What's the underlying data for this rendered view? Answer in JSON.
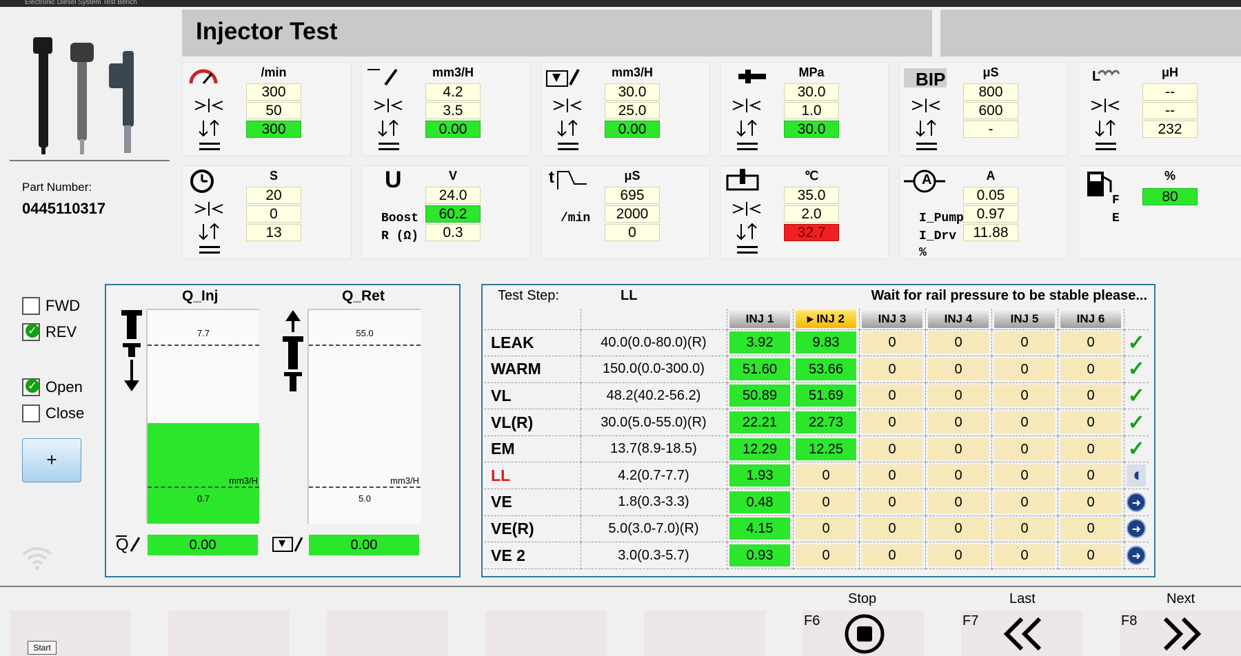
{
  "window": {
    "caption": "Electronic Diesel System Test Bench",
    "title": "Injector Test"
  },
  "part": {
    "label": "Part Number:",
    "value": "0445110317"
  },
  "panels": [
    {
      "unit": "/min",
      "values": [
        "300",
        "50",
        "300"
      ],
      "icon": "speed-gauge-icon"
    },
    {
      "unit": "mm3/H",
      "values": [
        "4.2",
        "3.5",
        "0.00"
      ],
      "icon": "injection-quantity-icon"
    },
    {
      "unit": "mm3/H",
      "values": [
        "30.0",
        "25.0",
        "0.00"
      ],
      "icon": "return-quantity-icon"
    },
    {
      "unit": "MPa",
      "values": [
        "30.0",
        "1.0",
        "30.0"
      ],
      "icon": "rail-pressure-icon"
    },
    {
      "unit": "μS",
      "values": [
        "800",
        "600",
        "-"
      ],
      "icon": "bip-icon",
      "label": "BIP"
    },
    {
      "unit": "μH",
      "values": [
        "--",
        "--",
        "232"
      ],
      "icon": "inductance-icon",
      "label": "L"
    },
    {
      "unit": "S",
      "values": [
        "20",
        "0",
        "13"
      ],
      "icon": "timer-icon"
    },
    {
      "unit": "V",
      "values": [
        "24.0",
        "60.2",
        "0.3"
      ],
      "icon": "voltage-icon",
      "labels": [
        "U",
        "Boost",
        "R (Ω)"
      ]
    },
    {
      "unit": "μS",
      "values": [
        "695",
        "2000",
        "0"
      ],
      "icon": "pulse-width-icon",
      "labels": [
        "t",
        "/min"
      ]
    },
    {
      "unit": "℃",
      "values": [
        "35.0",
        "2.0",
        "32.7"
      ],
      "icon": "temperature-icon"
    },
    {
      "unit": "A",
      "values": [
        "0.05",
        "0.97",
        "11.88"
      ],
      "icon": "current-icon",
      "labels": [
        "A",
        "I_Pump",
        "I_Drv",
        "%"
      ]
    },
    {
      "unit": "%",
      "values": [
        "80"
      ],
      "icon": "fuel-level-icon",
      "labels": [
        "F",
        "E"
      ]
    }
  ],
  "options": {
    "fwd": "FWD",
    "rev": "REV",
    "open": "Open",
    "close": "Close",
    "plus": "+"
  },
  "gauges": {
    "inj": {
      "title": "Q_Inj",
      "upper": "7.7",
      "lower": "0.7",
      "unit": "mm3/H",
      "value": "0.00",
      "fill": 0.47
    },
    "ret": {
      "title": "Q_Ret",
      "upper": "55.0",
      "lower": "5.0",
      "unit": "mm3/H",
      "value": "0.00",
      "fill": 0.0
    }
  },
  "results": {
    "step_label": "Test Step:",
    "step_value": "LL",
    "message": "Wait for rail pressure to be stable please...",
    "columns": [
      "INJ 1",
      "INJ 2",
      "INJ 3",
      "INJ 4",
      "INJ 5",
      "INJ 6"
    ],
    "active_column": "INJ 2",
    "rows": [
      {
        "name": "LEAK",
        "spec": "40.0(0.0-80.0)(R)",
        "values": [
          "3.92",
          "9.83",
          "0",
          "0",
          "0",
          "0"
        ],
        "status": "ok"
      },
      {
        "name": "WARM",
        "spec": "150.0(0.0-300.0)",
        "values": [
          "51.60",
          "53.66",
          "0",
          "0",
          "0",
          "0"
        ],
        "status": "ok"
      },
      {
        "name": "VL",
        "spec": "48.2(40.2-56.2)",
        "values": [
          "50.89",
          "51.69",
          "0",
          "0",
          "0",
          "0"
        ],
        "status": "ok"
      },
      {
        "name": "VL(R)",
        "spec": "30.0(5.0-55.0)(R)",
        "values": [
          "22.21",
          "22.73",
          "0",
          "0",
          "0",
          "0"
        ],
        "status": "ok"
      },
      {
        "name": "EM",
        "spec": "13.7(8.9-18.5)",
        "values": [
          "12.29",
          "12.25",
          "0",
          "0",
          "0",
          "0"
        ],
        "status": "ok"
      },
      {
        "name": "LL",
        "spec": "4.2(0.7-7.7)",
        "values": [
          "1.93",
          "0",
          "0",
          "0",
          "0",
          "0"
        ],
        "status": "busy"
      },
      {
        "name": "VE",
        "spec": "1.8(0.3-3.3)",
        "values": [
          "0.48",
          "0",
          "0",
          "0",
          "0",
          "0"
        ],
        "status": "pending"
      },
      {
        "name": "VE(R)",
        "spec": "5.0(3.0-7.0)(R)",
        "values": [
          "4.15",
          "0",
          "0",
          "0",
          "0",
          "0"
        ],
        "status": "pending"
      },
      {
        "name": "VE 2",
        "spec": "3.0(0.3-5.7)",
        "values": [
          "0.93",
          "0",
          "0",
          "0",
          "0",
          "0"
        ],
        "status": "pending"
      }
    ]
  },
  "footer": {
    "f6": {
      "key": "F6",
      "label": "Stop"
    },
    "f7": {
      "key": "F7",
      "label": "Last"
    },
    "f8": {
      "key": "F8",
      "label": "Next"
    },
    "start": "Start"
  },
  "colors": {
    "green": "#2ce62c",
    "cell": "#f6e8b9",
    "value_bg": "#ffffe1",
    "red": "#ee2020",
    "frame": "#2c7a9a"
  }
}
